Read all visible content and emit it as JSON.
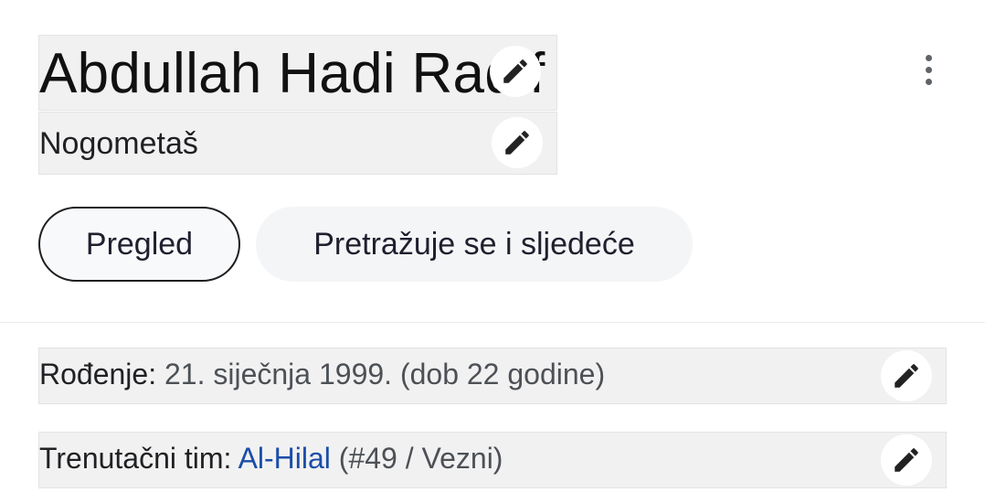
{
  "header": {
    "title": "Abdullah Hadi Radif",
    "subtitle": "Nogometaš",
    "title_edit_icon": "pencil-icon",
    "subtitle_edit_icon": "pencil-icon",
    "more_icon": "more-vert-icon"
  },
  "tabs": [
    {
      "label": "Pregled",
      "active": true
    },
    {
      "label": "Pretražuje se i sljedeće",
      "active": false
    }
  ],
  "facts": {
    "birth": {
      "label": "Rođenje:",
      "value": "21. siječnja 1999. (dob 22 godine)"
    },
    "team": {
      "label": "Trenutačni tim:",
      "link": "Al-Hilal",
      "extra": "(#49 / Vezni)"
    }
  },
  "colors": {
    "link": "#1a4da8",
    "box_bg": "#f1f1f1",
    "text": "#202124"
  }
}
